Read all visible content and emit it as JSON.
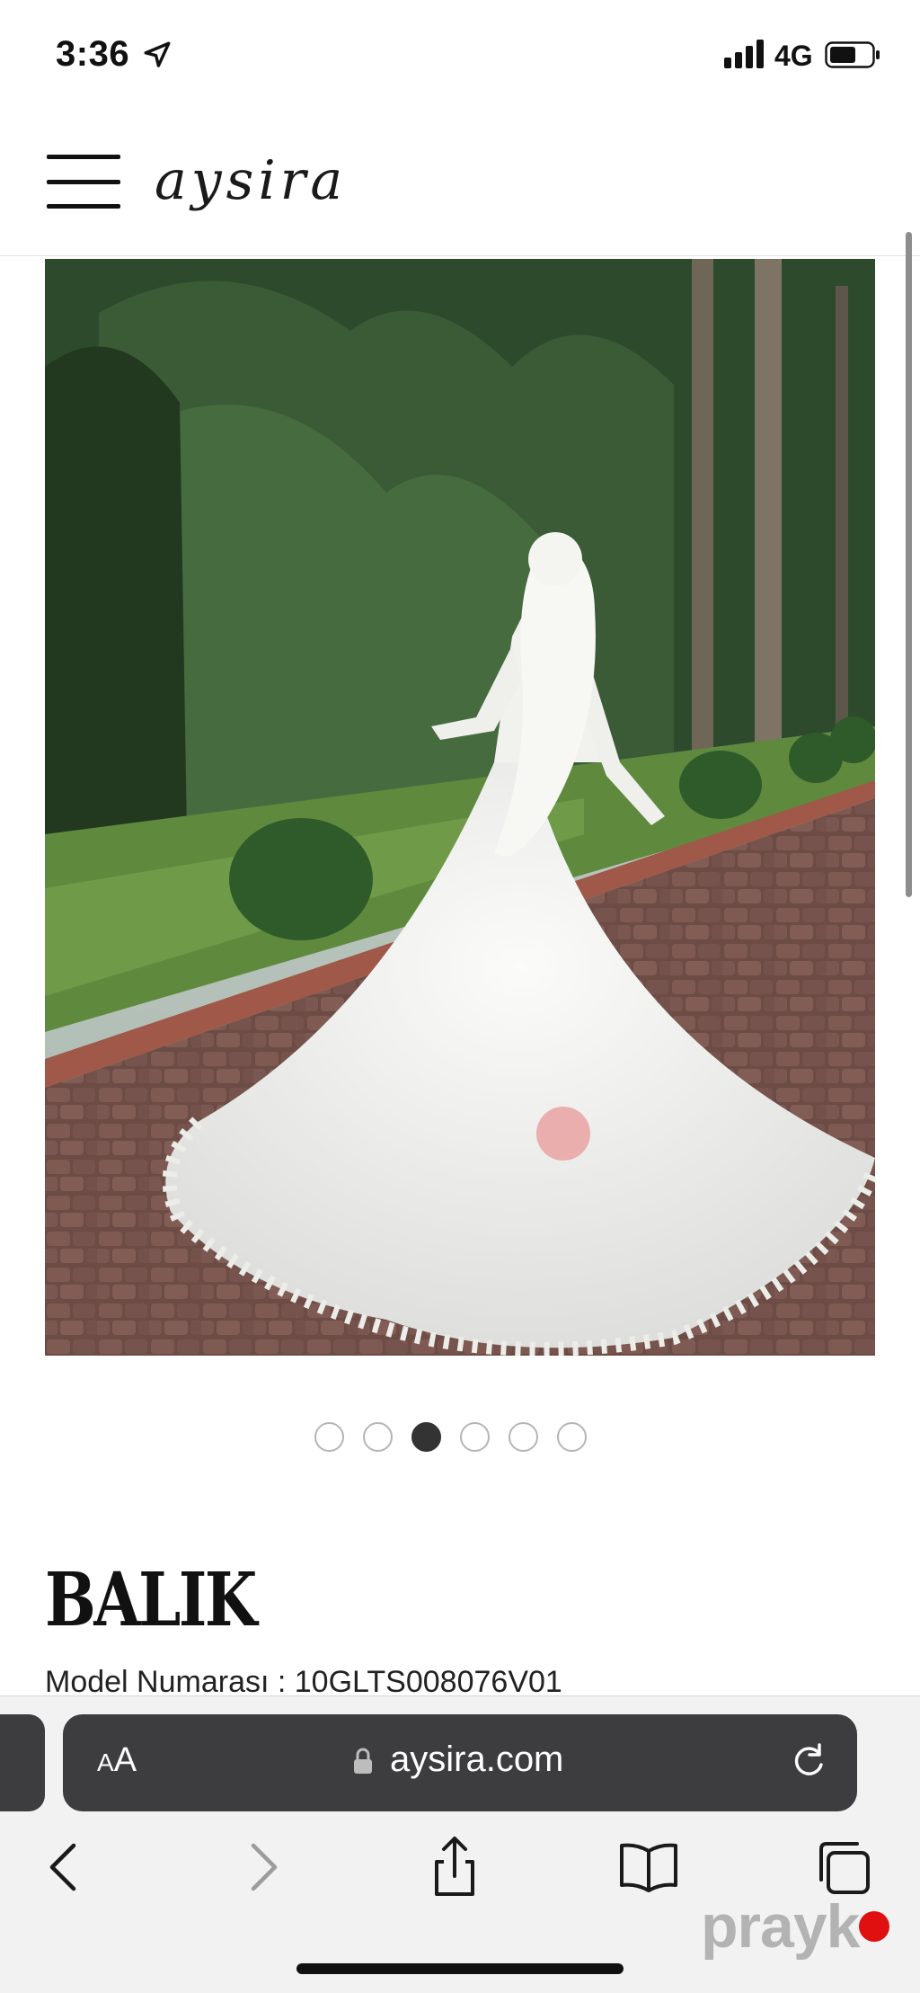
{
  "status_bar": {
    "time": "3:36",
    "network": "4G",
    "icons": [
      "location-arrow-icon",
      "signal-icon",
      "battery-icon"
    ]
  },
  "header": {
    "logo_text": "aysira",
    "menu_icon": "hamburger-menu-icon"
  },
  "carousel": {
    "total_slides": 6,
    "active_index": 2
  },
  "product": {
    "title": "BALIK",
    "model_label": "Model Numarası : ",
    "model_number": "10GLTS008076V01"
  },
  "browser": {
    "text_size_label_small": "A",
    "text_size_label_large": "A",
    "url": "aysira.com",
    "toolbar_icons": [
      "back-icon",
      "forward-icon",
      "share-icon",
      "bookmarks-icon",
      "tabs-icon"
    ]
  },
  "watermark": {
    "text": "prayk"
  },
  "colors": {
    "address_bar": "#3d3d3f",
    "toolbar_bg": "#f2f2f2",
    "dot_active": "#333333",
    "watermark_dot": "#e01010"
  }
}
